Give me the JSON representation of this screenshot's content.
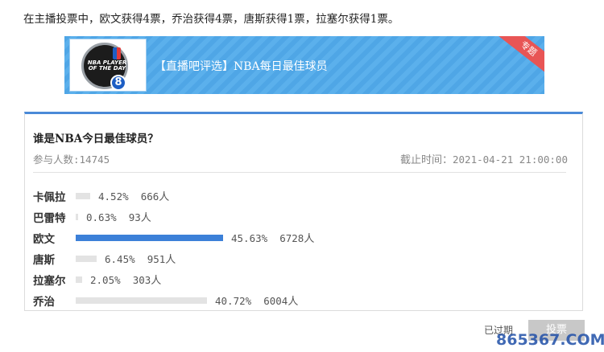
{
  "intro_text": "在主播投票中，欧文获得4票，乔治获得4票，唐斯获得1票，拉塞尔获得1票。",
  "banner": {
    "title": "【直播吧评选】NBA每日最佳球员",
    "ribbon": "专题",
    "logo_text": "NBA PLAYER OF THE DAY",
    "logo_number": "8"
  },
  "poll": {
    "question": "谁是NBA今日最佳球员？",
    "participants_label": "参与人数:",
    "participants_count": "14745",
    "deadline_label": "截止时间：",
    "deadline_value": "2021-04-21 21:00:00",
    "options": [
      {
        "name": "卡佩拉",
        "percent": "4.52%",
        "votes": "666",
        "unit": "人",
        "fraction": 0.0452,
        "color": "#e3e3e3"
      },
      {
        "name": "巴雷特",
        "percent": "0.63%",
        "votes": "93",
        "unit": "人",
        "fraction": 0.0063,
        "color": "#e3e3e3"
      },
      {
        "name": "欧文",
        "percent": "45.63%",
        "votes": "6728",
        "unit": "人",
        "fraction": 0.4563,
        "color": "#3c80d8"
      },
      {
        "name": "唐斯",
        "percent": "6.45%",
        "votes": "951",
        "unit": "人",
        "fraction": 0.0645,
        "color": "#e3e3e3"
      },
      {
        "name": "拉塞尔",
        "percent": "2.05%",
        "votes": "303",
        "unit": "人",
        "fraction": 0.0205,
        "color": "#e3e3e3"
      },
      {
        "name": "乔治",
        "percent": "40.72%",
        "votes": "6004",
        "unit": "人",
        "fraction": 0.4072,
        "color": "#e3e3e3"
      }
    ]
  },
  "footer": {
    "expired_label": "已过期",
    "vote_button": "投票"
  },
  "watermark": "865367.COM"
}
